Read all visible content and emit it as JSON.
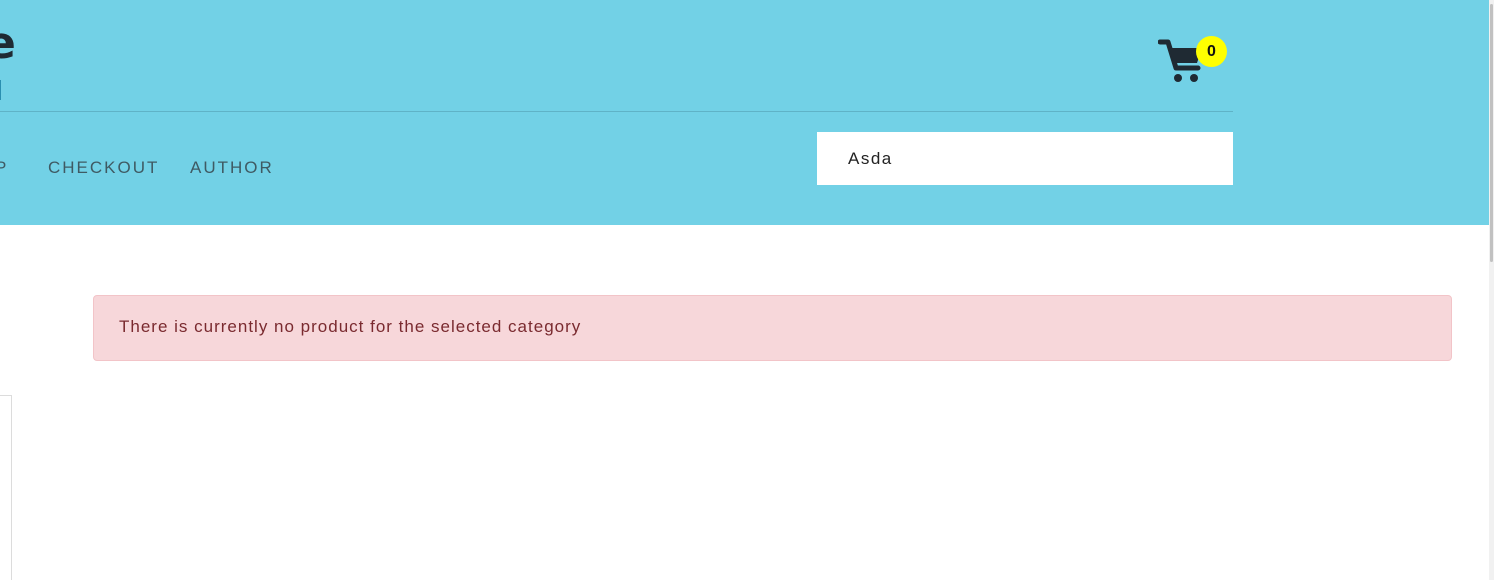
{
  "header": {
    "logo_fragment": "e",
    "nav": [
      "P",
      "CHECKOUT",
      "AUTHOR"
    ],
    "cart": {
      "icon": "shopping-cart-icon",
      "count": "0",
      "badge_color": "#ffff00"
    },
    "search": {
      "value": "Asda"
    },
    "background_color": "#72d1e6"
  },
  "alert": {
    "message": "There is currently no product for the selected category",
    "background_color": "#f7d7da",
    "text_color": "#7a2a2f"
  }
}
